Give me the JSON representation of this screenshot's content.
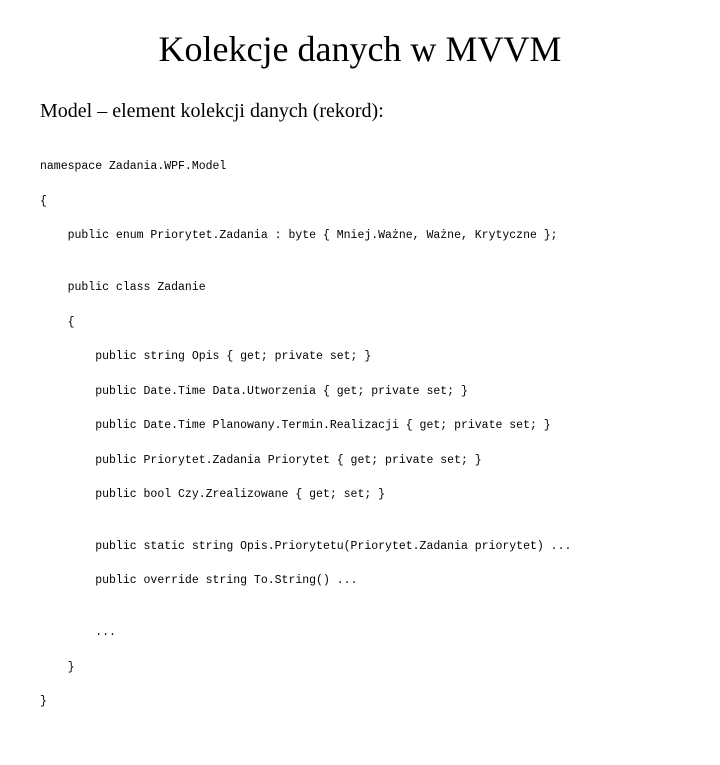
{
  "title": "Kolekcje danych w MVVM",
  "subtitle": "Model – element kolekcji danych (rekord):",
  "code_lines": {
    "l0": "namespace Zadania.WPF.Model",
    "l1": "{",
    "l2": "    public enum Priorytet.Zadania : byte { Mniej.Ważne, Ważne, Krytyczne };",
    "l3": "",
    "l4": "    public class Zadanie",
    "l5": "    {",
    "l6": "        public string Opis { get; private set; }",
    "l7": "        public Date.Time Data.Utworzenia { get; private set; }",
    "l8": "        public Date.Time Planowany.Termin.Realizacji { get; private set; }",
    "l9": "        public Priorytet.Zadania Priorytet { get; private set; }",
    "l10": "        public bool Czy.Zrealizowane { get; set; }",
    "l11": "",
    "l12": "        public static string Opis.Priorytetu(Priorytet.Zadania priorytet) ...",
    "l13": "        public override string To.String() ...",
    "l14": "",
    "l15": "        ...",
    "l16": "    }",
    "l17": "}"
  }
}
